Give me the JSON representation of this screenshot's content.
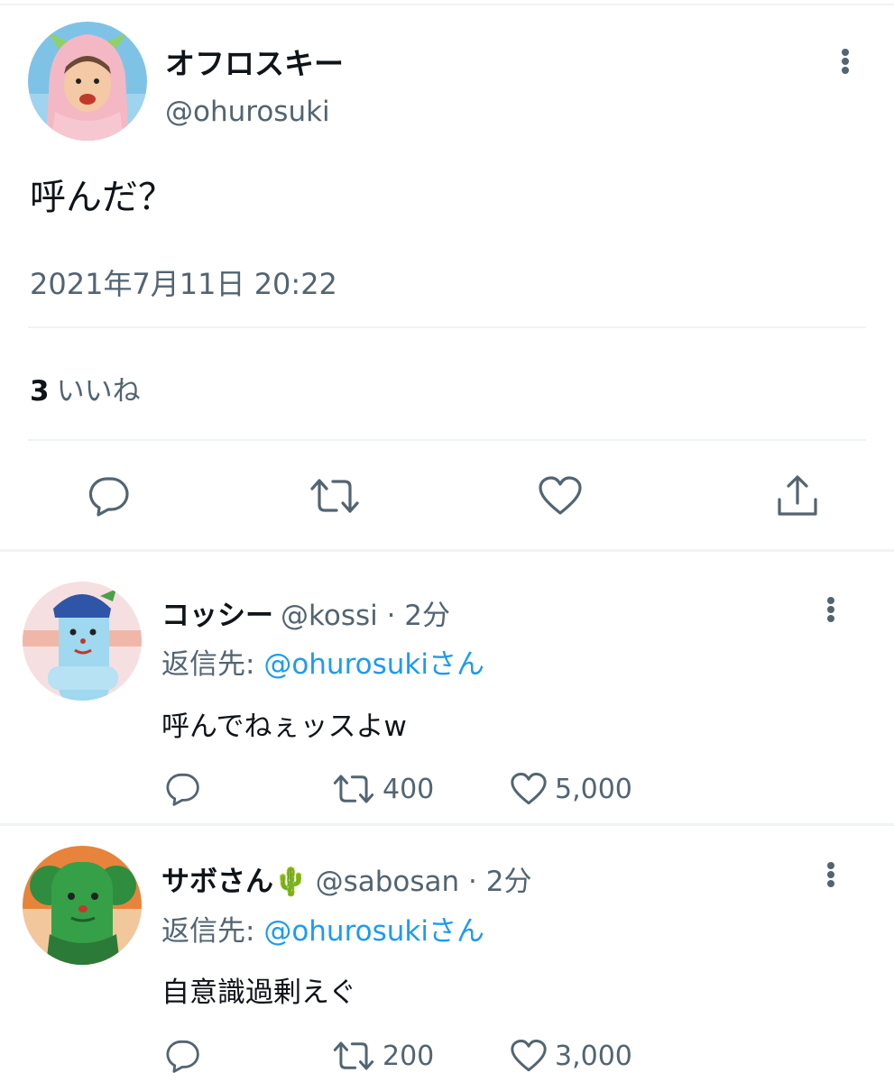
{
  "tweet": {
    "display_name": "オフロスキー",
    "handle": "@ohurosuki",
    "text": "呼んだ？",
    "timestamp": "2021年7月11日 20:22",
    "likes_count": "3",
    "likes_label": "いいね"
  },
  "actions": {
    "reply_icon": "reply-icon",
    "retweet_icon": "retweet-icon",
    "like_icon": "heart-icon",
    "share_icon": "share-icon"
  },
  "replies": [
    {
      "display_name": "コッシー",
      "meta": "@kossi · 2分",
      "reply_to_prefix": "返信先: ",
      "reply_to_mention": "@ohurosukiさん",
      "text": "呼んでねぇッスよw",
      "retweets": "400",
      "likes": "5,000"
    },
    {
      "display_name": "サボさん",
      "emoji": "🌵",
      "meta": "@sabosan · 2分",
      "reply_to_prefix": "返信先: ",
      "reply_to_mention": "@ohurosukiさん",
      "text": "自意識過剰えぐ",
      "retweets": "200",
      "likes": "3,000"
    }
  ],
  "colors": {
    "text_primary": "#0f1419",
    "text_secondary": "#536471",
    "link": "#1d9bf0",
    "divider": "#eff3f4"
  }
}
